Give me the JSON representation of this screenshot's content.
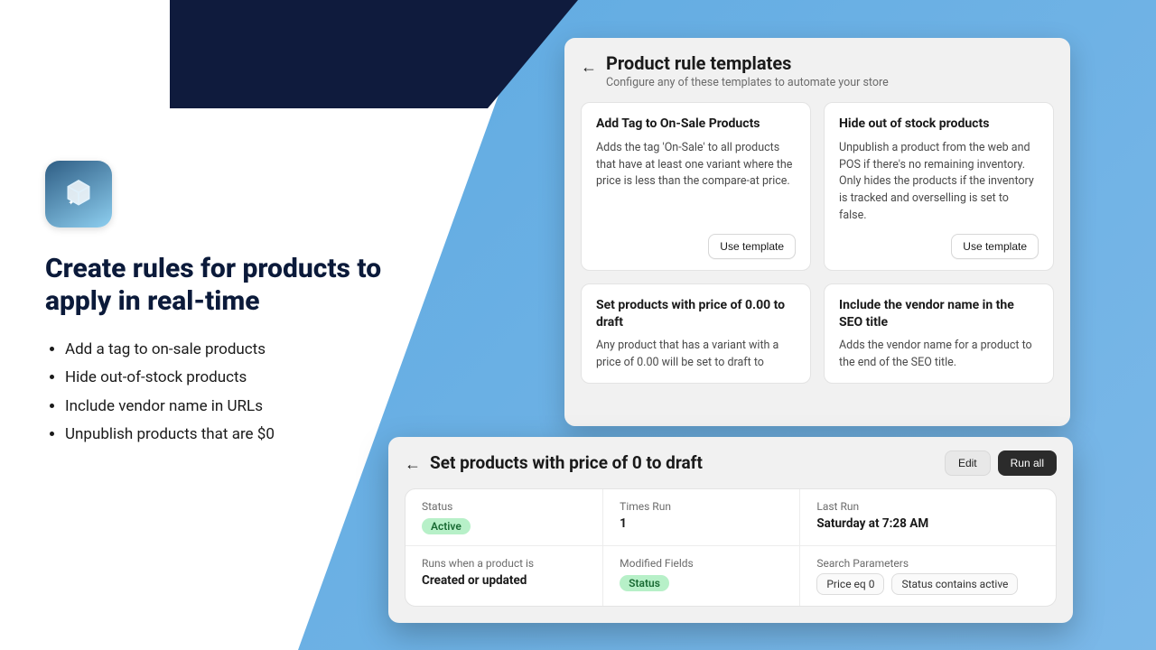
{
  "marketing": {
    "headline": "Create rules for products to apply in real-time",
    "bullets": [
      "Add a tag to on-sale products",
      "Hide out-of-stock products",
      "Include vendor name in URLs",
      "Unpublish products that are $0"
    ]
  },
  "templates_panel": {
    "title": "Product rule templates",
    "subtitle": "Configure any of these templates to automate your store",
    "use_template_label": "Use template",
    "cards": [
      {
        "title": "Add Tag to On-Sale Products",
        "desc": "Adds the tag 'On-Sale' to all products that have at least one variant where the price is less than the compare-at price."
      },
      {
        "title": "Hide out of stock products",
        "desc": "Unpublish a product from the web and POS if there's no remaining inventory. Only hides the products if the inventory is tracked and overselling is set to false."
      },
      {
        "title": "Set products with price of 0.00 to draft",
        "desc": "Any product that has a variant with a price of 0.00 will be set to draft to"
      },
      {
        "title": "Include the vendor name in the SEO title",
        "desc": "Adds the vendor name for a product to the end of the SEO title."
      }
    ]
  },
  "detail": {
    "title": "Set products with price of 0 to draft",
    "edit_label": "Edit",
    "run_all_label": "Run all",
    "row1": {
      "status_label": "Status",
      "status_value": "Active",
      "times_run_label": "Times Run",
      "times_run_value": "1",
      "last_run_label": "Last Run",
      "last_run_value": "Saturday at 7:28 AM"
    },
    "row2": {
      "runs_when_label": "Runs when a product is",
      "runs_when_value": "Created or updated",
      "modified_label": "Modified Fields",
      "modified_value": "Status",
      "search_label": "Search Parameters",
      "search_params": [
        "Price eq 0",
        "Status contains active"
      ]
    }
  }
}
